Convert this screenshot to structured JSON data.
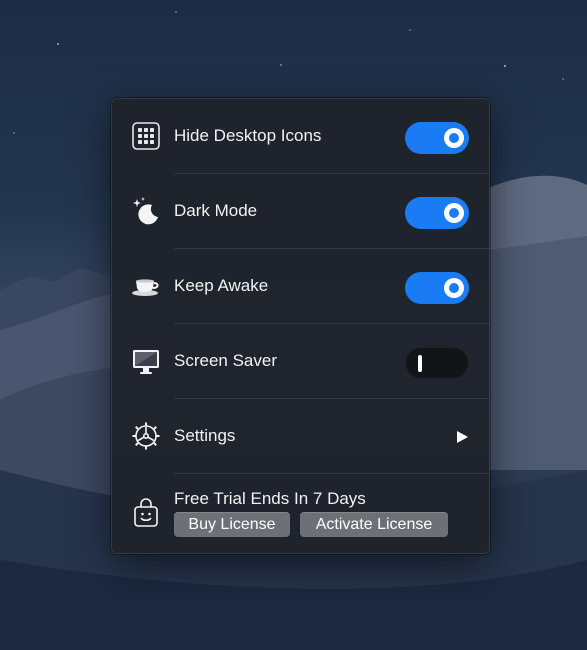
{
  "menu": {
    "items": [
      {
        "label": "Hide Desktop Icons",
        "icon": "grid-icon",
        "toggle": "on"
      },
      {
        "label": "Dark Mode",
        "icon": "moon-stars-icon",
        "toggle": "on"
      },
      {
        "label": "Keep Awake",
        "icon": "coffee-cup-icon",
        "toggle": "on"
      },
      {
        "label": "Screen Saver",
        "icon": "monitor-icon",
        "toggle": "off"
      },
      {
        "label": "Settings",
        "icon": "gear-icon",
        "action": "submenu-arrow"
      }
    ],
    "trial": {
      "title": "Free Trial Ends In 7 Days",
      "icon": "shopping-bag-icon",
      "buy_label": "Buy License",
      "activate_label": "Activate License"
    }
  },
  "colors": {
    "accent": "#1a7cf5",
    "panel": "#1e222a",
    "button": "#6e7077"
  }
}
